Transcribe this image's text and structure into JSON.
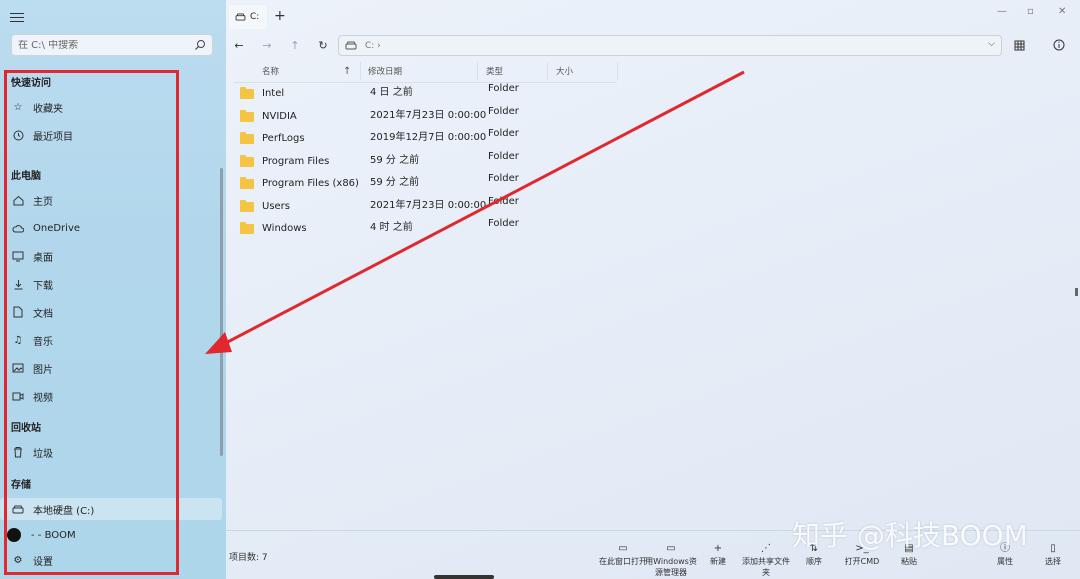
{
  "sidebar": {
    "search_placeholder": "在 C:\\ 中搜索",
    "quick_access": "快速访问",
    "favorites": "收藏夹",
    "recent": "最近项目",
    "this_pc": "此电脑",
    "home": "主页",
    "onedrive": "OneDrive",
    "desktop": "桌面",
    "downloads": "下载",
    "documents": "文档",
    "music": "音乐",
    "pictures": "图片",
    "videos": "视频",
    "recycle_bin": "回收站",
    "trash": "垃圾",
    "storage": "存储",
    "local_disk": "本地硬盘 (C:)",
    "boom": "- - BOOM",
    "settings": "设置"
  },
  "tab": {
    "label": "C:"
  },
  "address": {
    "path": "C: ›"
  },
  "columns": {
    "name": "名称",
    "modified": "修改日期",
    "type": "类型",
    "size": "大小"
  },
  "rows": [
    {
      "name": "Intel",
      "date": "4 日 之前",
      "type": "Folder"
    },
    {
      "name": "NVIDIA",
      "date": "2021年7月23日 0:00:00",
      "type": "Folder"
    },
    {
      "name": "PerfLogs",
      "date": "2019年12月7日 0:00:00",
      "type": "Folder"
    },
    {
      "name": "Program Files",
      "date": "59 分 之前",
      "type": "Folder"
    },
    {
      "name": "Program Files (x86)",
      "date": "59 分 之前",
      "type": "Folder"
    },
    {
      "name": "Users",
      "date": "2021年7月23日 0:00:00",
      "type": "Folder"
    },
    {
      "name": "Windows",
      "date": "4 时 之前",
      "type": "Folder"
    }
  ],
  "status": {
    "item_count": "项目数: 7"
  },
  "actions": [
    {
      "label": "在此窗口打开"
    },
    {
      "label": "用Windows资源管理器"
    },
    {
      "label": "新建"
    },
    {
      "label": "添加共享文件夹"
    },
    {
      "label": "顺序"
    },
    {
      "label": "打开CMD"
    },
    {
      "label": "粘贴"
    },
    {
      "label": "属性"
    },
    {
      "label": "选择"
    }
  ],
  "watermark": "知乎 @科技BOOM",
  "colors": {
    "annotation": "#e0282e",
    "folder": "#f6c443"
  }
}
